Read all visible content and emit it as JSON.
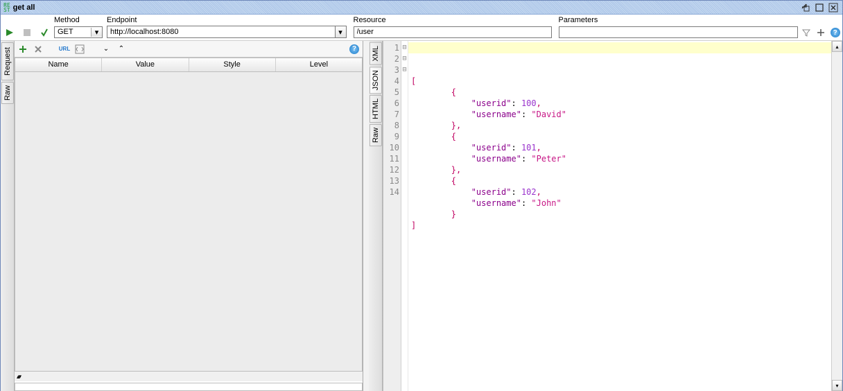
{
  "window": {
    "title": "get all"
  },
  "toolbar": {
    "method_label": "Method",
    "method_value": "GET",
    "endpoint_label": "Endpoint",
    "endpoint_value": "http://localhost:8080",
    "resource_label": "Resource",
    "resource_value": "/user",
    "parameters_label": "Parameters",
    "parameters_value": ""
  },
  "left_tabs": {
    "request": "Request",
    "raw": "Raw"
  },
  "grid_headers": {
    "name": "Name",
    "value": "Value",
    "style": "Style",
    "level": "Level"
  },
  "right_tabs": {
    "xml": "XML",
    "json": "JSON",
    "html": "HTML",
    "raw": "Raw"
  },
  "response": {
    "lines": [
      {
        "n": 1,
        "fold": "",
        "indent": 0,
        "tokens": [
          {
            "t": "[",
            "c": "punct"
          }
        ]
      },
      {
        "n": 2,
        "fold": "⊟",
        "indent": 8,
        "tokens": [
          {
            "t": "{",
            "c": "punct"
          }
        ]
      },
      {
        "n": 3,
        "fold": "",
        "indent": 12,
        "tokens": [
          {
            "t": "\"userid\"",
            "c": "key"
          },
          {
            "t": ": ",
            "c": ""
          },
          {
            "t": "100",
            "c": "num"
          },
          {
            "t": ",",
            "c": "punct"
          }
        ]
      },
      {
        "n": 4,
        "fold": "",
        "indent": 12,
        "tokens": [
          {
            "t": "\"username\"",
            "c": "key"
          },
          {
            "t": ": ",
            "c": ""
          },
          {
            "t": "\"David\"",
            "c": "str"
          }
        ]
      },
      {
        "n": 5,
        "fold": "",
        "indent": 8,
        "tokens": [
          {
            "t": "},",
            "c": "punct"
          }
        ]
      },
      {
        "n": 6,
        "fold": "⊟",
        "indent": 8,
        "tokens": [
          {
            "t": "{",
            "c": "punct"
          }
        ]
      },
      {
        "n": 7,
        "fold": "",
        "indent": 12,
        "tokens": [
          {
            "t": "\"userid\"",
            "c": "key"
          },
          {
            "t": ": ",
            "c": ""
          },
          {
            "t": "101",
            "c": "num"
          },
          {
            "t": ",",
            "c": "punct"
          }
        ]
      },
      {
        "n": 8,
        "fold": "",
        "indent": 12,
        "tokens": [
          {
            "t": "\"username\"",
            "c": "key"
          },
          {
            "t": ": ",
            "c": ""
          },
          {
            "t": "\"Peter\"",
            "c": "str"
          }
        ]
      },
      {
        "n": 9,
        "fold": "",
        "indent": 8,
        "tokens": [
          {
            "t": "},",
            "c": "punct"
          }
        ]
      },
      {
        "n": 10,
        "fold": "⊟",
        "indent": 8,
        "tokens": [
          {
            "t": "{",
            "c": "punct"
          }
        ]
      },
      {
        "n": 11,
        "fold": "",
        "indent": 12,
        "tokens": [
          {
            "t": "\"userid\"",
            "c": "key"
          },
          {
            "t": ": ",
            "c": ""
          },
          {
            "t": "102",
            "c": "num"
          },
          {
            "t": ",",
            "c": "punct"
          }
        ]
      },
      {
        "n": 12,
        "fold": "",
        "indent": 12,
        "tokens": [
          {
            "t": "\"username\"",
            "c": "key"
          },
          {
            "t": ": ",
            "c": ""
          },
          {
            "t": "\"John\"",
            "c": "str"
          }
        ]
      },
      {
        "n": 13,
        "fold": "",
        "indent": 8,
        "tokens": [
          {
            "t": "}",
            "c": "punct"
          }
        ]
      },
      {
        "n": 14,
        "fold": "",
        "indent": 0,
        "tokens": [
          {
            "t": "]",
            "c": "punct"
          }
        ]
      }
    ]
  }
}
